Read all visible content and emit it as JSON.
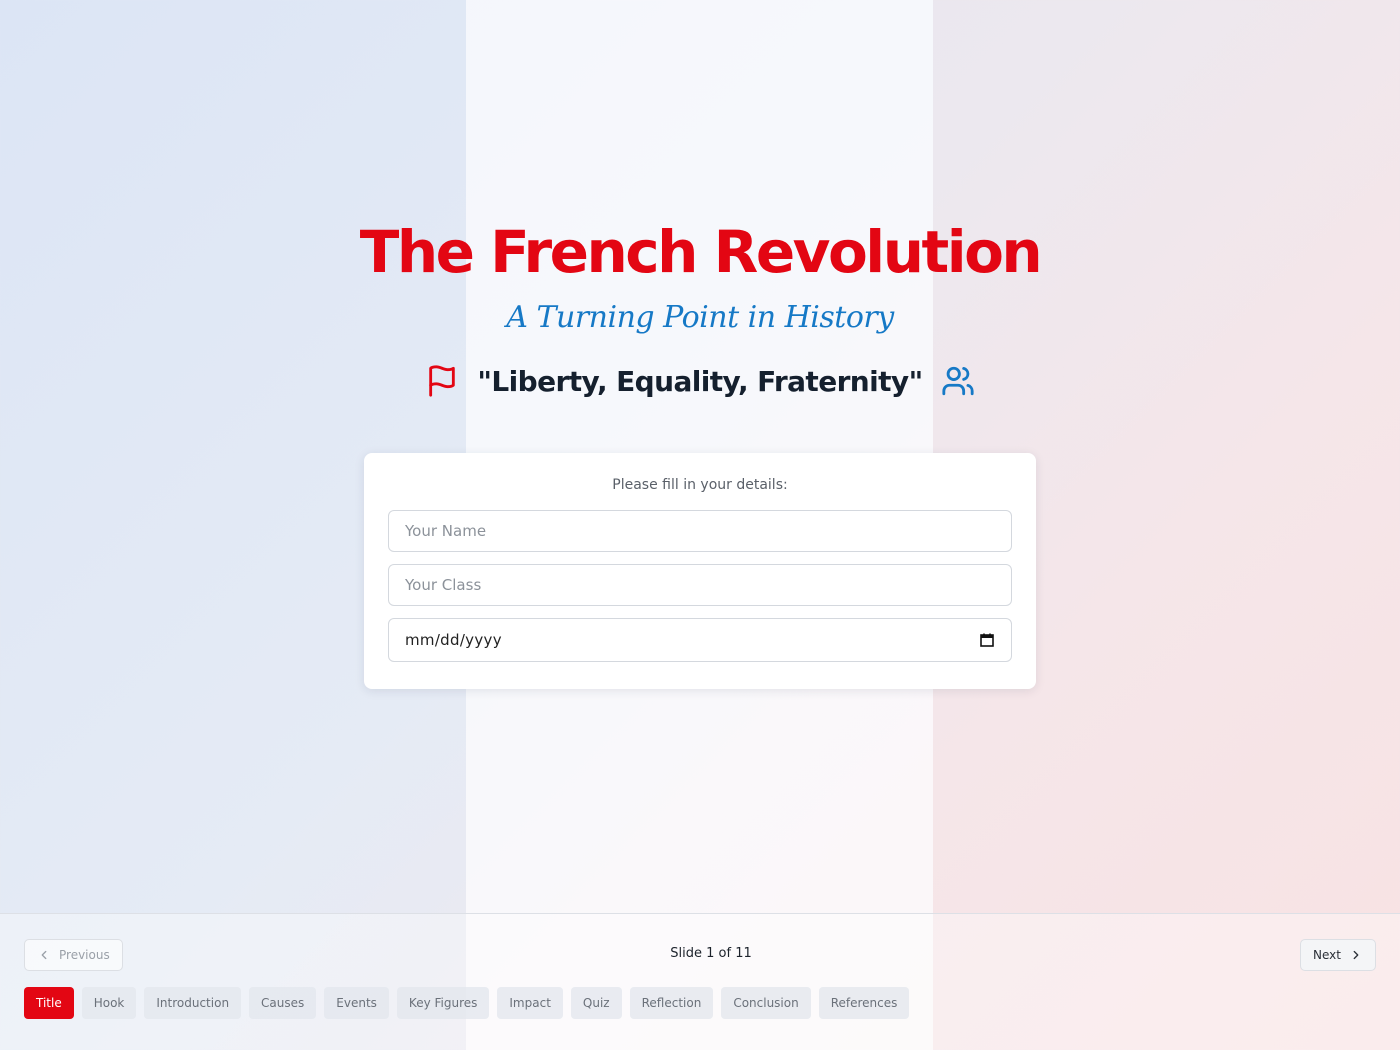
{
  "slide": {
    "title": "The French Revolution",
    "subtitle": "A Turning Point in History",
    "motto": "\"Liberty, Equality, Fraternity\"",
    "icons": {
      "left": "flag-icon",
      "right": "users-icon"
    },
    "colors": {
      "red": "#e30613",
      "blue": "#1679c6",
      "dark": "#15202e"
    }
  },
  "form": {
    "prompt": "Please fill in your details:",
    "name_placeholder": "Your Name",
    "class_placeholder": "Your Class",
    "date_placeholder": "mm/dd/yyyy"
  },
  "footer": {
    "previous_label": "Previous",
    "next_label": "Next",
    "counter": "Slide 1 of 11",
    "tabs": [
      {
        "label": "Title",
        "active": true
      },
      {
        "label": "Hook",
        "active": false
      },
      {
        "label": "Introduction",
        "active": false
      },
      {
        "label": "Causes",
        "active": false
      },
      {
        "label": "Events",
        "active": false
      },
      {
        "label": "Key Figures",
        "active": false
      },
      {
        "label": "Impact",
        "active": false
      },
      {
        "label": "Quiz",
        "active": false
      },
      {
        "label": "Reflection",
        "active": false
      },
      {
        "label": "Conclusion",
        "active": false
      },
      {
        "label": "References",
        "active": false
      }
    ]
  }
}
